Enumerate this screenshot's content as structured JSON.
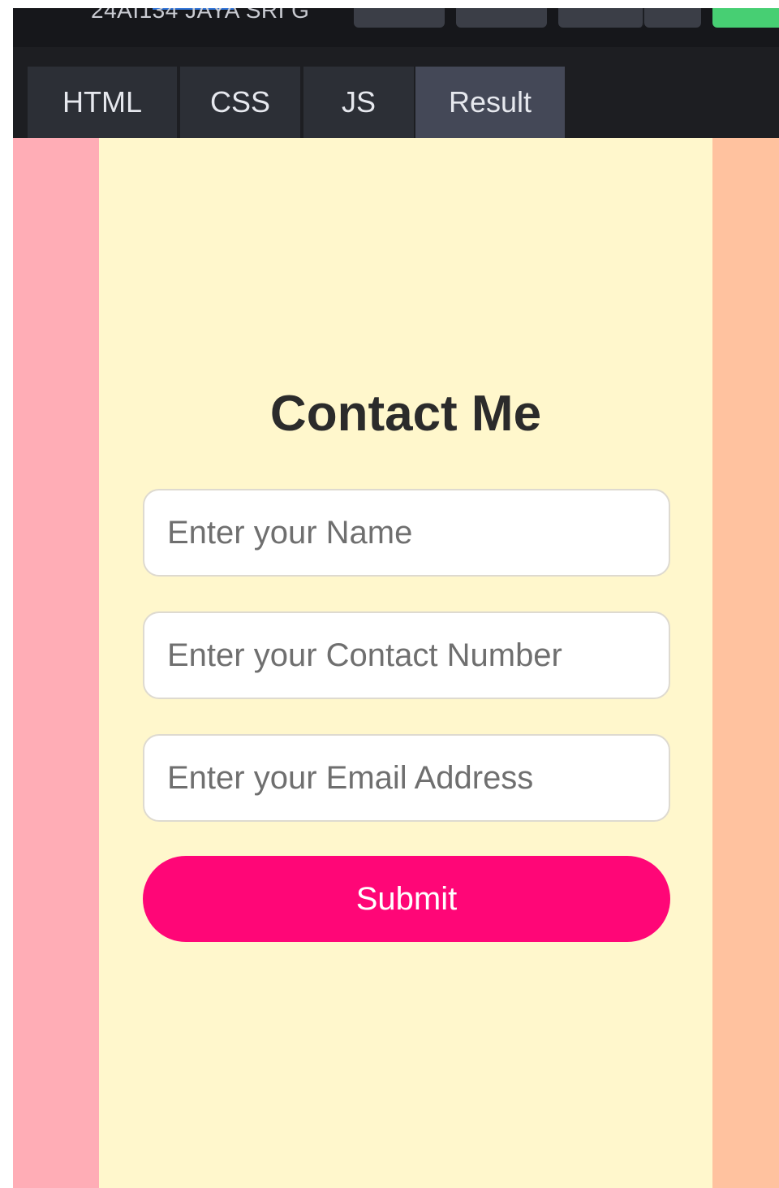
{
  "editor": {
    "pen_title": "24AI134 JAYA SRI G",
    "tabs": [
      {
        "label": "HTML",
        "active": false
      },
      {
        "label": "CSS",
        "active": false
      },
      {
        "label": "JS",
        "active": false
      },
      {
        "label": "Result",
        "active": true
      }
    ]
  },
  "contact_form": {
    "heading": "Contact Me",
    "name_placeholder": "Enter your Name",
    "contact_placeholder": "Enter your Contact Number",
    "email_placeholder": "Enter your Email Address",
    "submit_label": "Submit"
  },
  "colors": {
    "background_main": "#fff7cc",
    "stripe_left": "#ffadb6",
    "stripe_right": "#ffc29f",
    "submit_button": "#ff0677",
    "editor_dark": "#1d1e22",
    "tab_active": "#444857",
    "run_button": "#47cf73"
  }
}
